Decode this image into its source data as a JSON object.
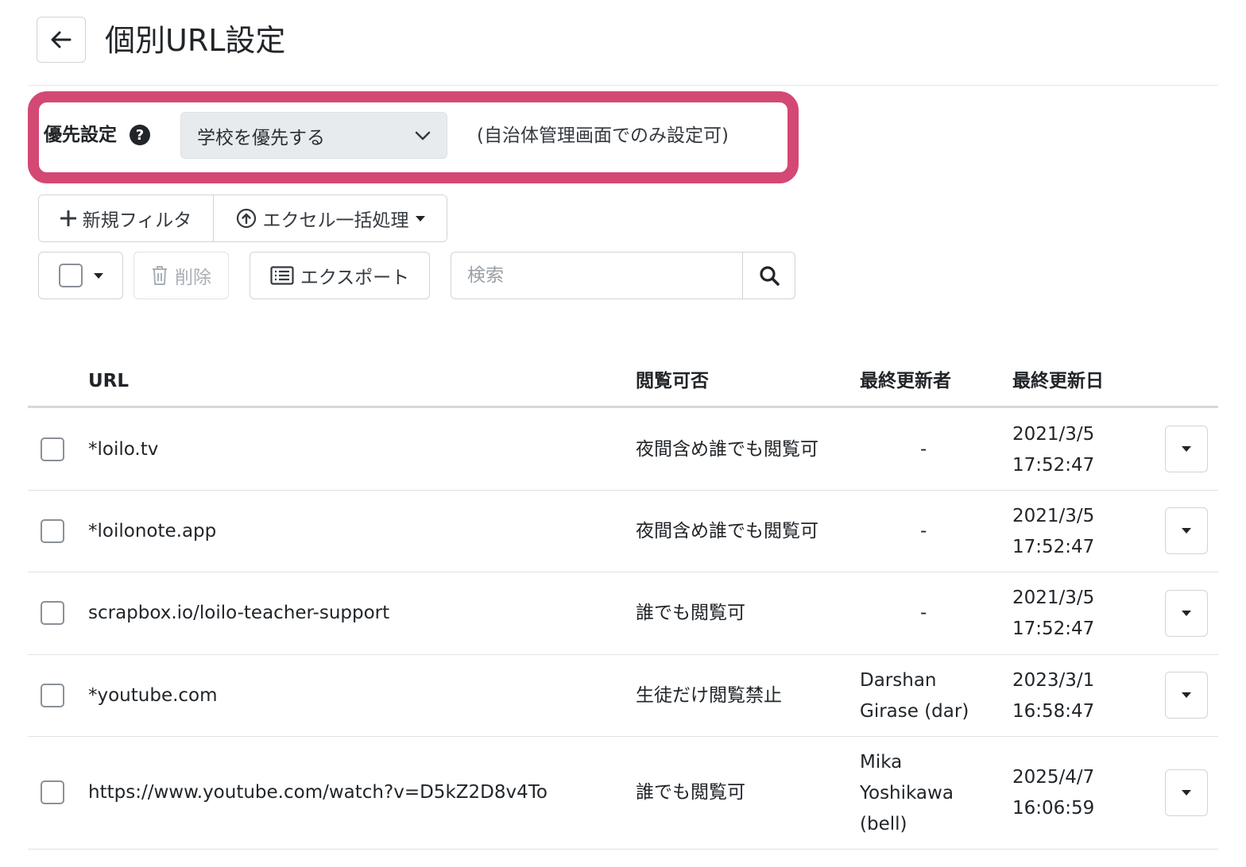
{
  "header": {
    "title": "個別URL設定"
  },
  "priority": {
    "label": "優先設定",
    "help": "?",
    "selected": "学校を優先する",
    "note": "(自治体管理画面でのみ設定可)"
  },
  "toolbar": {
    "new_filter": "新規フィルタ",
    "excel_bulk": "エクセル一括処理",
    "delete": "削除",
    "export": "エクスポート",
    "search_placeholder": "検索"
  },
  "table": {
    "headers": {
      "url": "URL",
      "access": "閲覧可否",
      "updated_by": "最終更新者",
      "updated_at": "最終更新日"
    },
    "rows": [
      {
        "url": "*loilo.tv",
        "access": "夜間含め誰でも閲覧可",
        "updated_by": [
          "-"
        ],
        "date": "2021/3/5",
        "time": "17:52:47"
      },
      {
        "url": "*loilonote.app",
        "access": "夜間含め誰でも閲覧可",
        "updated_by": [
          "-"
        ],
        "date": "2021/3/5",
        "time": "17:52:47"
      },
      {
        "url": "scrapbox.io/loilo-teacher-support",
        "access": "誰でも閲覧可",
        "updated_by": [
          "-"
        ],
        "date": "2021/3/5",
        "time": "17:52:47"
      },
      {
        "url": "*youtube.com",
        "access": "生徒だけ閲覧禁止",
        "updated_by": [
          "Darshan",
          "Girase (dar)"
        ],
        "date": "2023/3/1",
        "time": "16:58:47"
      },
      {
        "url": "https://www.youtube.com/watch?v=D5kZ2D8v4To",
        "access": "誰でも閲覧可",
        "updated_by": [
          "Mika",
          "Yoshikawa",
          "(bell)"
        ],
        "date": "2025/4/7",
        "time": "16:06:59"
      }
    ]
  },
  "colors": {
    "highlight": "#d44874",
    "select_bg": "#e8ebee"
  }
}
